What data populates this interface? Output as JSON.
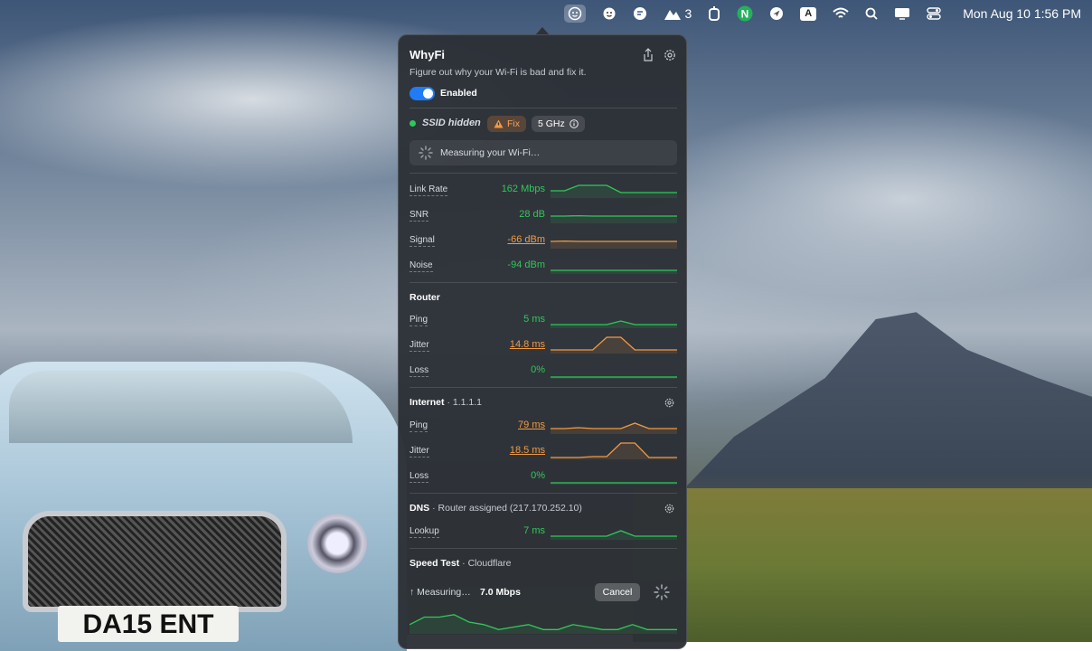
{
  "menubar": {
    "items": [
      {
        "icon": "whyfi-face-icon",
        "active": true
      },
      {
        "icon": "whyfi-face-2-icon"
      },
      {
        "icon": "chat-bubble-icon"
      },
      {
        "icon": "mountain-icon",
        "badge": "3"
      },
      {
        "icon": "bracket-icon"
      },
      {
        "icon": "n-app-icon"
      },
      {
        "icon": "send-arrow-icon"
      },
      {
        "icon": "input-a-icon",
        "label": "A"
      },
      {
        "icon": "wifi-icon"
      },
      {
        "icon": "search-icon"
      },
      {
        "icon": "display-icon"
      },
      {
        "icon": "control-center-icon"
      }
    ],
    "clock": "Mon Aug 10  1:56 PM"
  },
  "wallpaper": {
    "plate_text": "DA15 ENT"
  },
  "popup": {
    "title": "WhyFi",
    "subtitle": "Figure out why your Wi-Fi is bad and fix it.",
    "toggle_label": "Enabled",
    "toggle_on": true,
    "ssid": "SSID hidden",
    "fix_label": "Fix",
    "band_label": "5 GHz",
    "measuring_text": "Measuring your Wi-Fi…",
    "wifi_metrics": [
      {
        "label": "Link Rate",
        "value": "162 Mbps",
        "status": "good",
        "spark": [
          3,
          3,
          6,
          6,
          6,
          2,
          2,
          2,
          2,
          2
        ]
      },
      {
        "label": "SNR",
        "value": "28 dB",
        "status": "good",
        "spark": [
          3,
          3,
          3.2,
          3,
          3,
          3,
          3,
          3,
          3,
          3
        ]
      },
      {
        "label": "Signal",
        "value": "-66 dBm",
        "status": "warn",
        "spark": [
          3,
          3.2,
          3,
          3,
          3,
          3,
          3,
          3,
          3,
          3
        ]
      },
      {
        "label": "Noise",
        "value": "-94 dBm",
        "status": "good",
        "spark": [
          1,
          1,
          1,
          1,
          1,
          1,
          1,
          1,
          1,
          1
        ]
      }
    ],
    "router": {
      "title": "Router",
      "metrics": [
        {
          "label": "Ping",
          "value": "5 ms",
          "status": "good",
          "spark": [
            1,
            1,
            1,
            1,
            1,
            3,
            1,
            1,
            1,
            1
          ]
        },
        {
          "label": "Jitter",
          "value": "14.8 ms",
          "status": "warn",
          "spark": [
            1,
            1,
            1,
            1,
            8,
            8,
            1,
            1,
            1,
            1
          ]
        },
        {
          "label": "Loss",
          "value": "0%",
          "status": "good",
          "spark": [
            0,
            0,
            0,
            0,
            0,
            0,
            0,
            0,
            0,
            0
          ]
        }
      ]
    },
    "internet": {
      "title": "Internet",
      "sub": "1.1.1.1",
      "metrics": [
        {
          "label": "Ping",
          "value": "79 ms",
          "status": "warn",
          "spark": [
            2,
            2,
            2.5,
            2,
            2,
            2,
            5,
            2,
            2,
            2
          ]
        },
        {
          "label": "Jitter",
          "value": "18.5 ms",
          "status": "warn",
          "spark": [
            0,
            0,
            0,
            0.5,
            0.5,
            8,
            8,
            0,
            0,
            0
          ]
        },
        {
          "label": "Loss",
          "value": "0%",
          "status": "good",
          "spark": [
            0,
            0,
            0,
            0,
            0,
            0,
            0,
            0,
            0,
            0
          ]
        }
      ]
    },
    "dns": {
      "title": "DNS",
      "sub": "Router assigned (217.170.252.10)",
      "metrics": [
        {
          "label": "Lookup",
          "value": "7 ms",
          "status": "good",
          "spark": [
            1,
            1,
            1,
            1,
            1,
            4,
            1,
            1,
            1,
            1
          ]
        }
      ]
    },
    "speedtest": {
      "title": "Speed Test",
      "sub": "Cloudflare",
      "status": "↑ Measuring…",
      "value": "7.0 Mbps",
      "cancel_label": "Cancel",
      "spark": [
        3,
        6,
        6,
        7,
        4,
        3,
        1,
        2,
        3,
        1,
        1,
        3,
        2,
        1,
        1,
        3,
        1,
        1,
        1
      ]
    }
  },
  "colors": {
    "good": "#2ec958",
    "warn": "#f39a40",
    "accent": "#1f7cf4"
  }
}
